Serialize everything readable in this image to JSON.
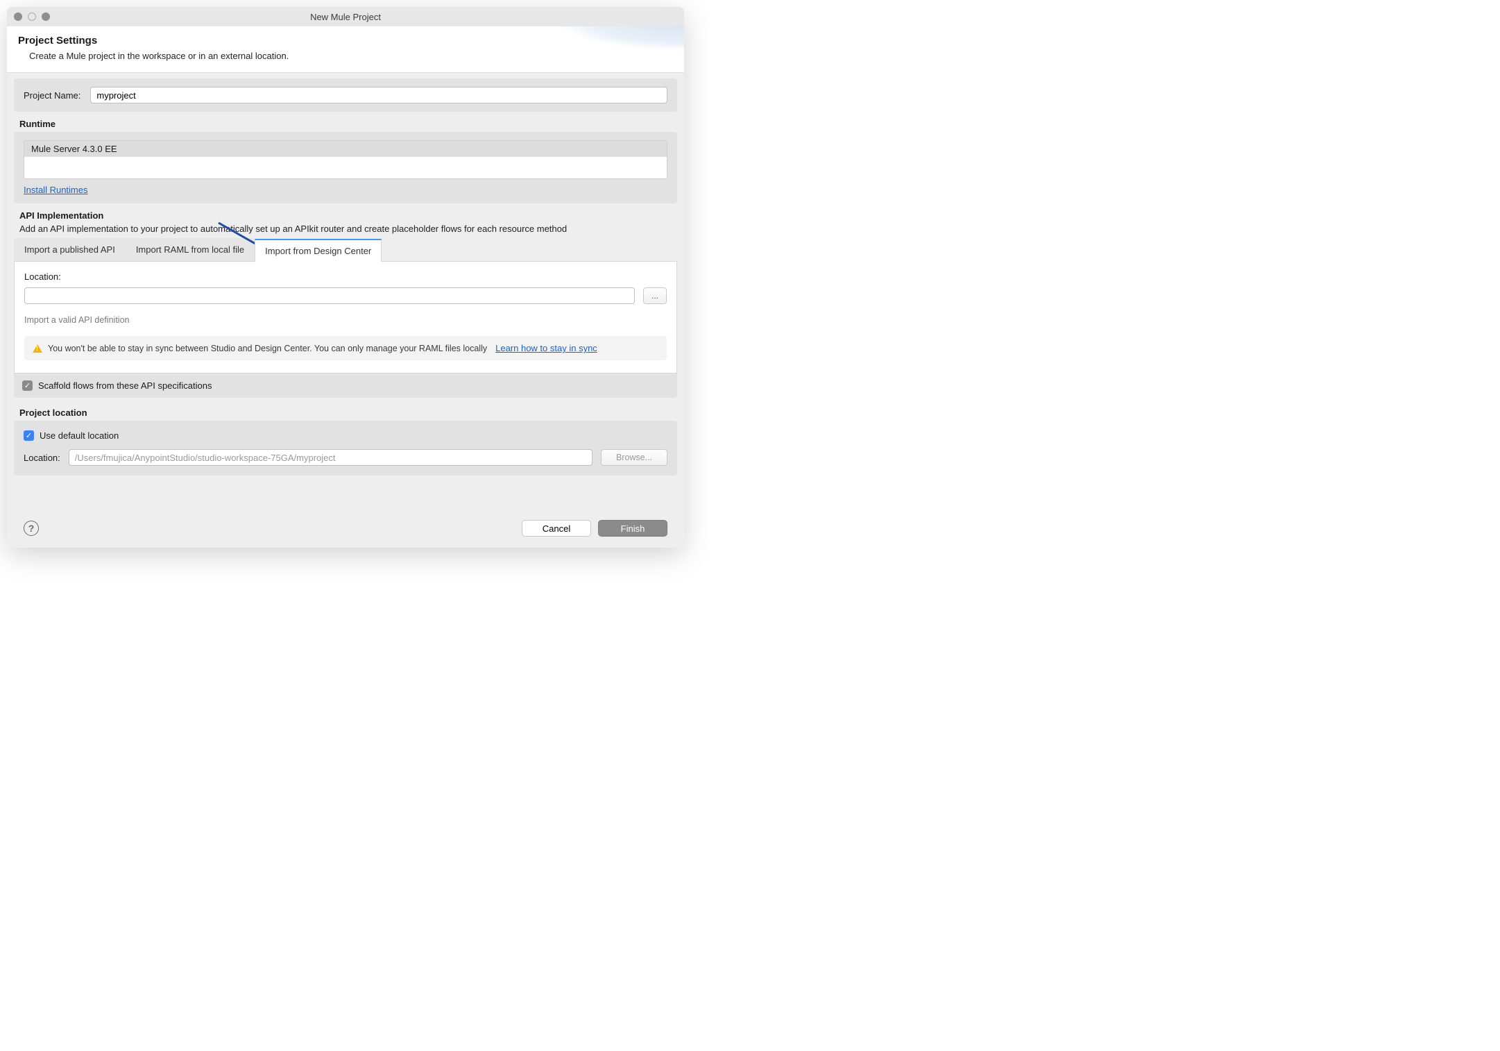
{
  "window": {
    "title": "New Mule Project"
  },
  "header": {
    "title": "Project Settings",
    "description": "Create a Mule project in the workspace or in an external location."
  },
  "projectName": {
    "label": "Project Name:",
    "value": "myproject"
  },
  "runtime": {
    "title": "Runtime",
    "selected": "Mule Server 4.3.0 EE",
    "installLink": "Install Runtimes"
  },
  "apiImpl": {
    "title": "API Implementation",
    "description": "Add an API implementation to your project to automatically set up an APIkit router and create placeholder flows for each resource method",
    "tabs": [
      {
        "label": "Import a published API"
      },
      {
        "label": "Import RAML from local file"
      },
      {
        "label": "Import from Design Center"
      }
    ],
    "locationLabel": "Location:",
    "locationValue": "",
    "browseDots": "...",
    "hint": "Import a valid API definition",
    "warning": "You won't be able to stay in sync between Studio and Design Center. You can only manage your RAML files locally",
    "warningLink": "Learn how to stay in sync",
    "scaffoldLabel": "Scaffold flows from these API specifications"
  },
  "projectLocation": {
    "title": "Project location",
    "useDefaultLabel": "Use default location",
    "locationLabel": "Location:",
    "locationValue": "/Users/fmujica/AnypointStudio/studio-workspace-75GA/myproject",
    "browseLabel": "Browse..."
  },
  "footer": {
    "cancel": "Cancel",
    "finish": "Finish"
  }
}
